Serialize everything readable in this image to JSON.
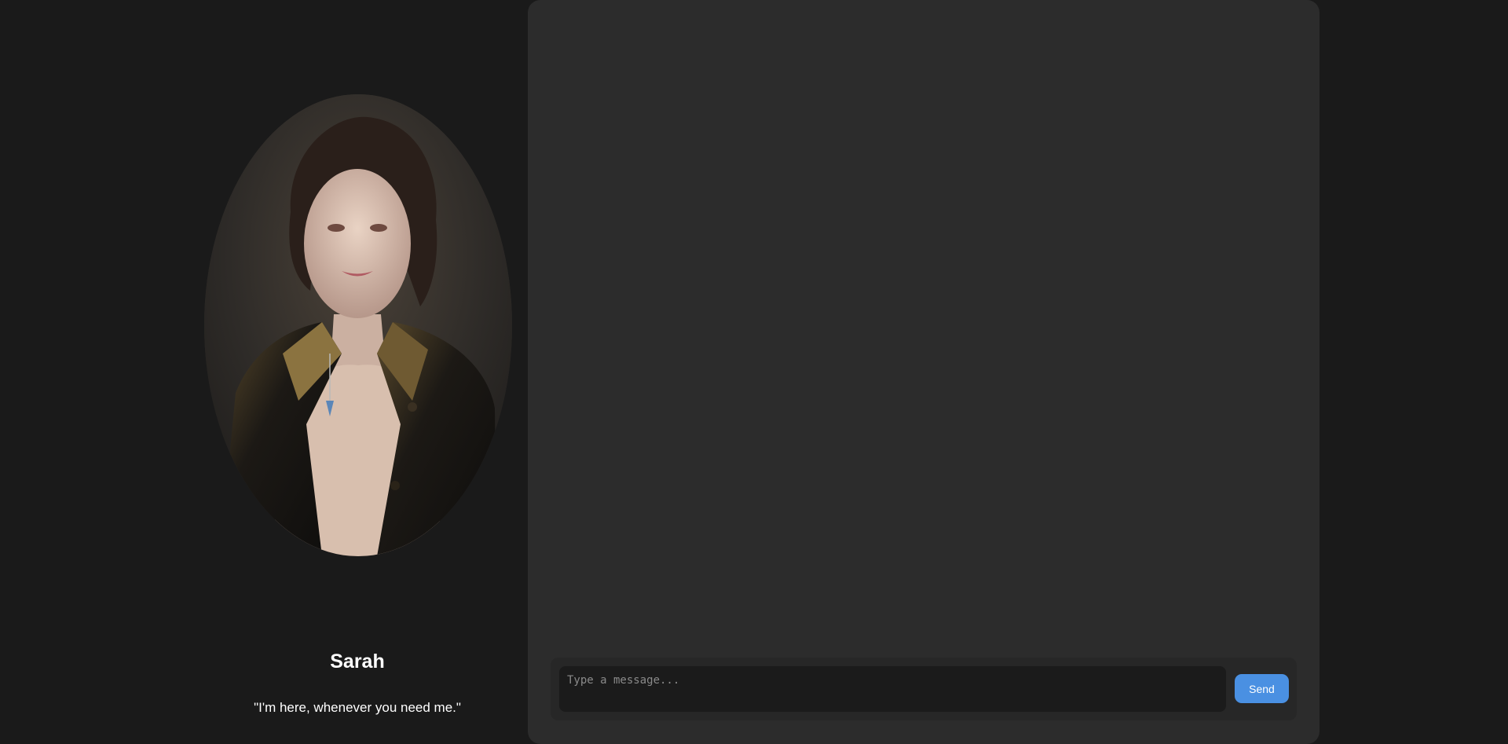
{
  "profile": {
    "name": "Sarah",
    "quote": "\"I'm here, whenever you need me.\""
  },
  "chat": {
    "input_placeholder": "Type a message...",
    "input_value": "",
    "send_label": "Send"
  },
  "colors": {
    "page_background": "#1a1a1a",
    "panel_background": "#2c2c2c",
    "input_background": "#1b1b1b",
    "accent": "#4a90e2"
  }
}
